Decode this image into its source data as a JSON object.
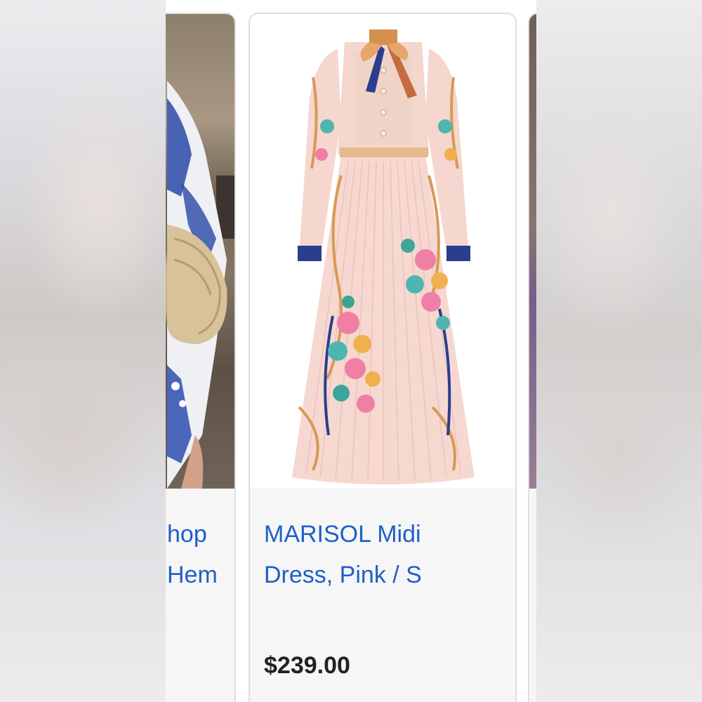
{
  "products": [
    {
      "title_lines": [
        "hop",
        "Hem"
      ]
    },
    {
      "title_lines": [
        "MARISOL Midi",
        "Dress, Pink / S"
      ],
      "price": "$239.00"
    }
  ],
  "colors": {
    "link": "#1f5fc7",
    "price": "#222222",
    "card_border": "#dedede",
    "card_body_bg": "#f6f6f7",
    "dress_pink": "#f6d8d1"
  },
  "icons": {
    "left_card_image": "model-photo-blue-print-dress",
    "main_card_image": "pink-floral-pleated-midi-dress",
    "right_card_image": "purple-dress-photo"
  }
}
